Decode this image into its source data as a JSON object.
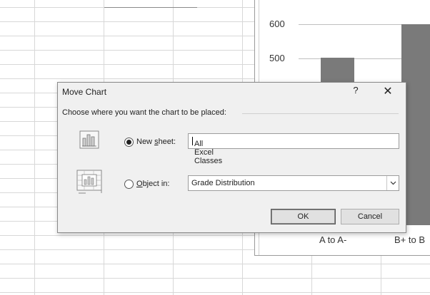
{
  "chart": {
    "y_ticks": [
      "600",
      "500"
    ],
    "categories": [
      "A to A-",
      "B+ to B"
    ]
  },
  "dialog": {
    "title": "Move Chart",
    "help_label": "?",
    "close_label": "✕",
    "prompt": "Choose where you want the chart to be placed:",
    "new_sheet": {
      "prefix": "New ",
      "accel": "s",
      "suffix": "heet:",
      "value": "All Excel Classes",
      "selected": true
    },
    "object_in": {
      "accel": "O",
      "suffix": "bject in:",
      "value": "Grade Distribution",
      "selected": false
    },
    "ok_label": "OK",
    "cancel_label": "Cancel"
  },
  "icons": {
    "new_sheet_icon": "chart-sheet-icon",
    "object_icon": "embedded-chart-icon",
    "dropdown_icon": "chevron-down-icon"
  },
  "colors": {
    "bar": "#7a7a7a",
    "dialog_bg": "#f0f0f0"
  }
}
